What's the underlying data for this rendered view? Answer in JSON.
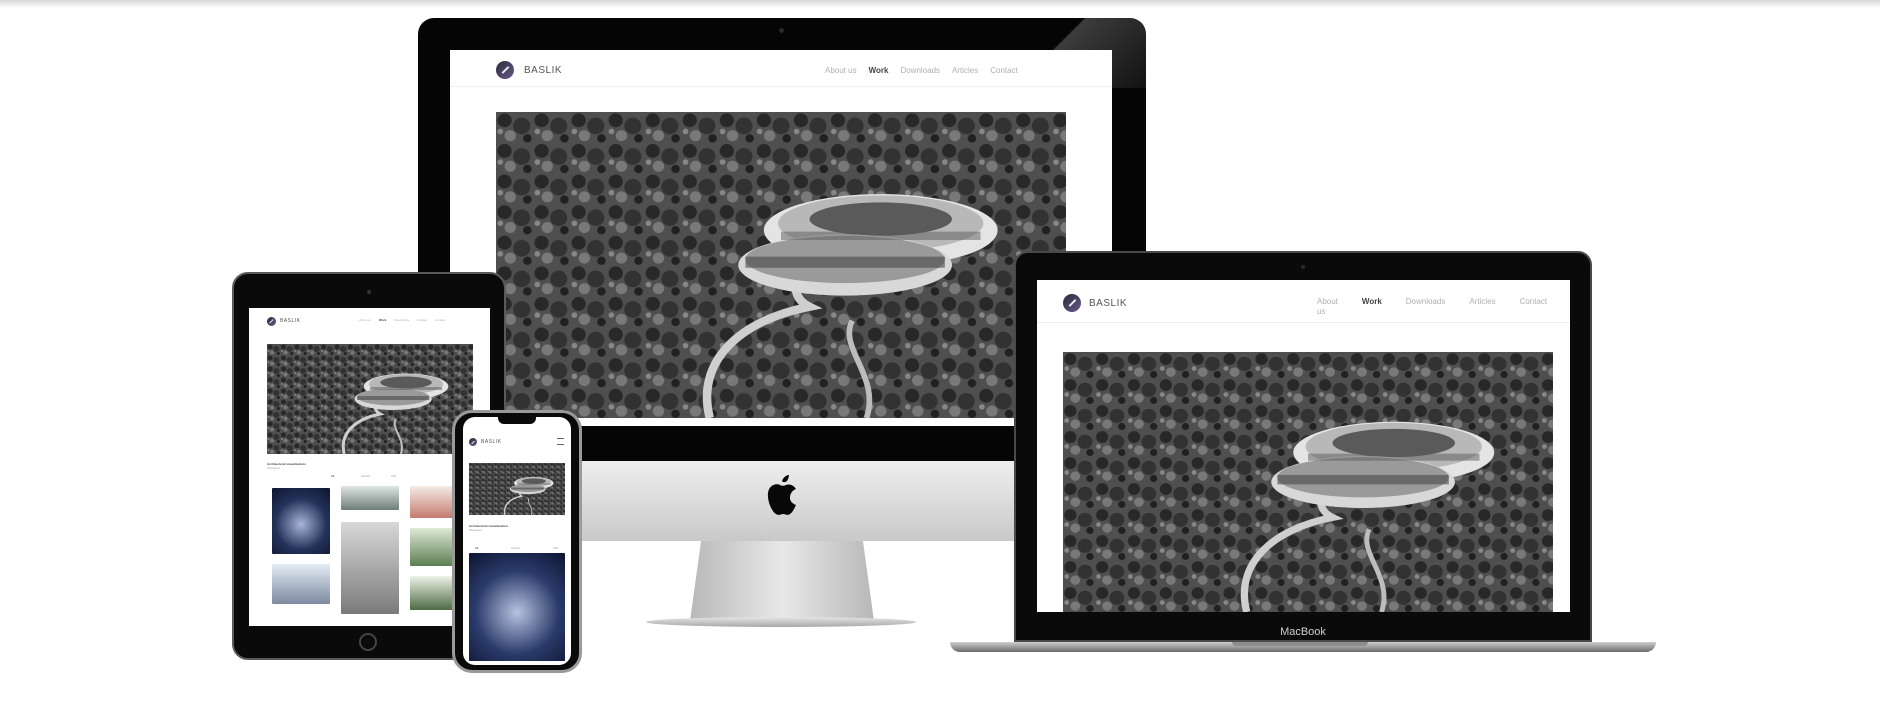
{
  "site": {
    "brand": "BASLIK",
    "nav": [
      {
        "label": "About us",
        "active": false
      },
      {
        "label": "Work",
        "active": true
      },
      {
        "label": "Downloads",
        "active": false
      },
      {
        "label": "Articles",
        "active": false
      },
      {
        "label": "Contact",
        "active": false
      }
    ],
    "laptop_nav": [
      {
        "label": "About\nus",
        "active": false
      },
      {
        "label": "Work",
        "active": true
      },
      {
        "label": "Downloads",
        "active": false
      },
      {
        "label": "Articles",
        "active": false
      },
      {
        "label": "Contact",
        "active": false
      }
    ],
    "section_title": "Architectural visualizations",
    "section_sub": "Showreel",
    "filters": [
      "All",
      "Interior",
      "CGI"
    ]
  },
  "devices": {
    "laptop_label": "MacBook"
  },
  "colors": {
    "bezel": "#0a0a0a",
    "nav_active": "#444444",
    "nav_inactive": "#b0b0b0",
    "logo_accent": "#6a5a8a"
  }
}
